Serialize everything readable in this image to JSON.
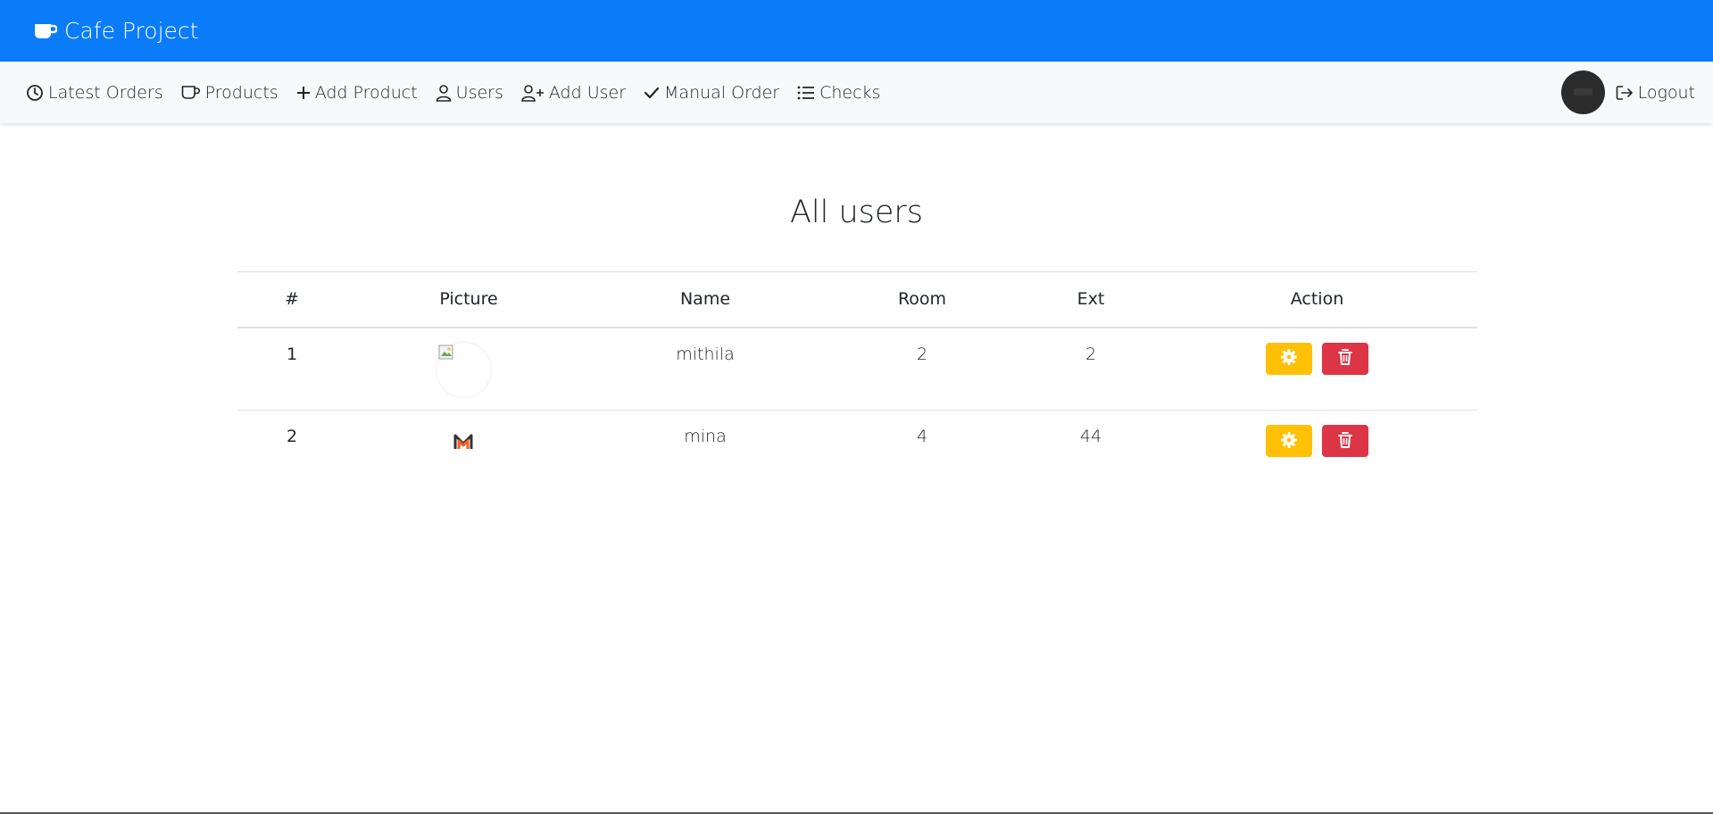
{
  "brand": {
    "title": "Cafe Project"
  },
  "nav": {
    "items": [
      {
        "label": "Latest Orders",
        "icon": "clock-icon"
      },
      {
        "label": "Products",
        "icon": "cup-icon"
      },
      {
        "label": "Add Product",
        "icon": "plus-icon"
      },
      {
        "label": "Users",
        "icon": "person-icon"
      },
      {
        "label": "Add User",
        "icon": "person-plus-icon"
      },
      {
        "label": "Manual Order",
        "icon": "check-icon"
      },
      {
        "label": "Checks",
        "icon": "list-icon"
      }
    ],
    "logout_label": "Logout"
  },
  "main": {
    "title": "All users",
    "table": {
      "headers": [
        "#",
        "Picture",
        "Name",
        "Room",
        "Ext",
        "Action"
      ],
      "rows": [
        {
          "index": "1",
          "name": "mithila",
          "room": "2",
          "ext": "2",
          "picture": "broken-image-icon"
        },
        {
          "index": "2",
          "name": "mina",
          "room": "4",
          "ext": "44",
          "picture": "m-logo"
        }
      ]
    }
  },
  "colors": {
    "brand_bar": "#0a7cf9",
    "warning": "#ffc107",
    "danger": "#dc3545"
  }
}
